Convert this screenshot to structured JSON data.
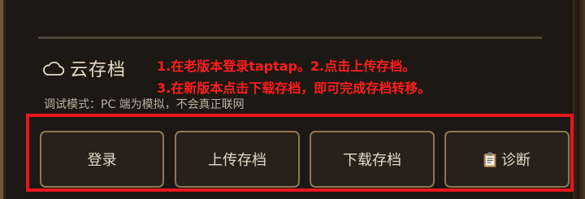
{
  "section": {
    "title": "云存档",
    "icon": "cloud-icon"
  },
  "instructions": {
    "line1": "1.在老版本登录taptap。2.点击上传存档。",
    "line2": "3.在新版本点击下载存档，即可完成存档转移。",
    "color": "#ff1d1d"
  },
  "debug_text": "调试模式：PC 端为模拟，不会真正联网",
  "buttons": {
    "login": "登录",
    "upload": "上传存档",
    "download": "下载存档",
    "diagnose": "诊断",
    "diagnose_icon": "clipboard-icon"
  },
  "colors": {
    "highlight": "#e8161b",
    "button_border": "#8d7756",
    "panel_bg": "#1c1813"
  }
}
